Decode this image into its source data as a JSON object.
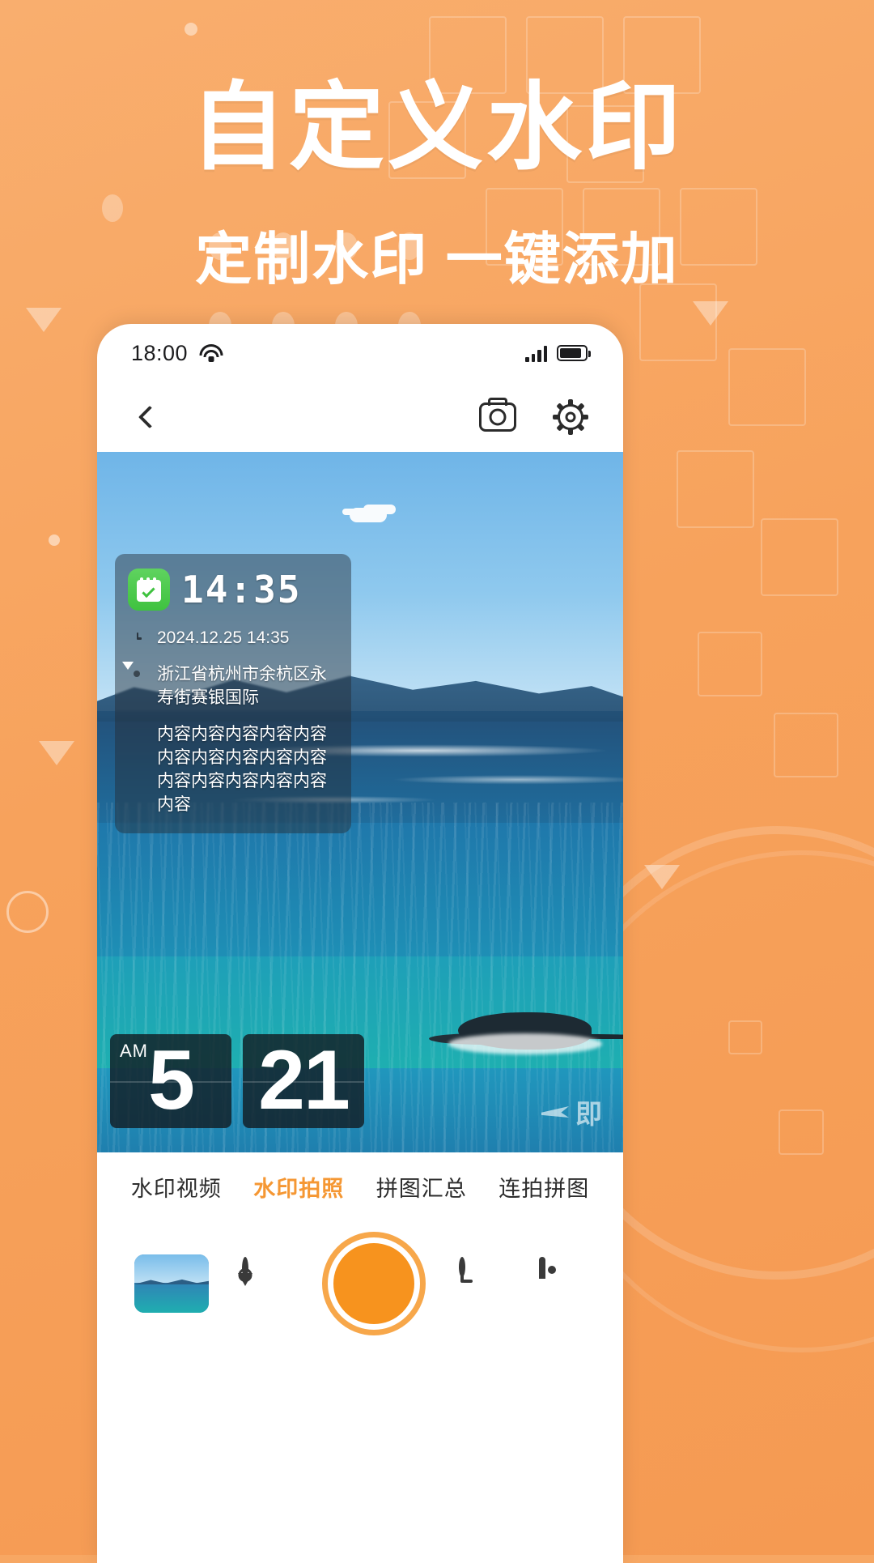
{
  "promo": {
    "headline": "自定义水印",
    "subhead": "定制水印 一键添加",
    "accent_color": "#f7931e",
    "background_color": "#f7a763"
  },
  "phone": {
    "status_bar": {
      "time": "18:00",
      "wifi_icon": "wifi-icon",
      "signal_icon": "signal-bars-icon",
      "battery_icon": "battery-icon"
    },
    "toolbar": {
      "back_icon": "back-chevron-icon",
      "camera_icon": "camera-icon",
      "settings_icon": "gear-icon"
    },
    "preview": {
      "watermark_card": {
        "app_icon": "calendar-check-icon",
        "clock": "14:35",
        "rows": [
          {
            "icon": "clock-icon",
            "text": "2024.12.25 14:35"
          },
          {
            "icon": "location-pin-icon",
            "text": "浙江省杭州市余杭区永寿街赛银国际"
          },
          {
            "icon": "bookmark-icon",
            "text": "内容内容内容内容内容内容内容内容内容内容内容内容内容内容内容内容"
          }
        ]
      },
      "flip_clock": {
        "meridiem": "AM",
        "hour": "5",
        "minute": "21"
      },
      "brand_mark": "即"
    },
    "tabs": [
      {
        "label": "水印视频",
        "active": false
      },
      {
        "label": "水印拍照",
        "active": true
      },
      {
        "label": "拼图汇总",
        "active": false
      },
      {
        "label": "连拍拼图",
        "active": false
      }
    ],
    "action_bar": {
      "gallery_thumb": "photo-thumbnail",
      "location_icon": "location-pin-icon",
      "shutter": "shutter-button",
      "timer_icon": "clock-icon",
      "albums_icon": "gallery-icon"
    }
  }
}
